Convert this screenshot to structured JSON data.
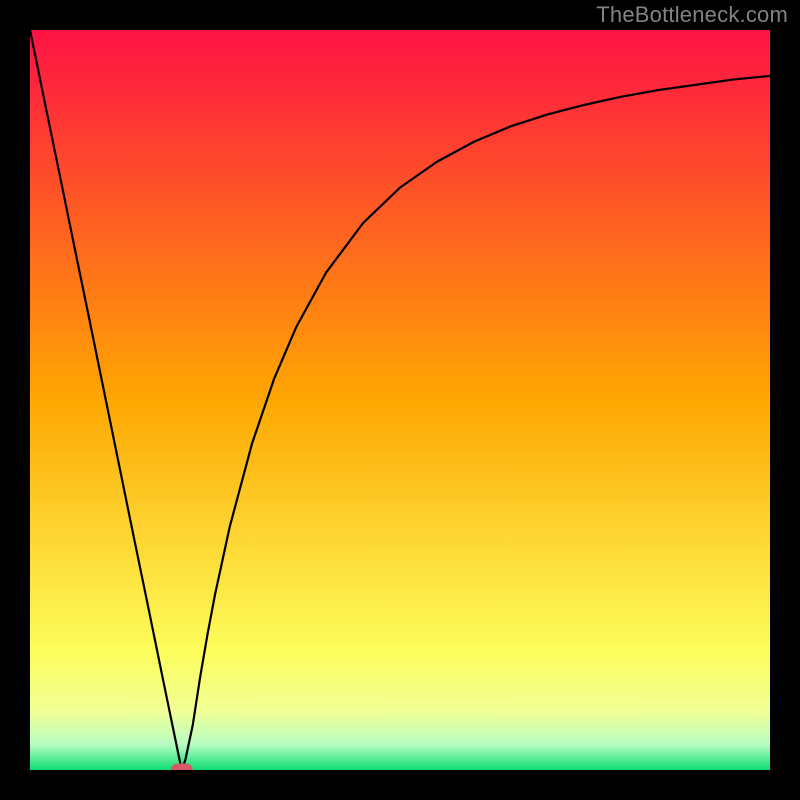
{
  "watermark": "TheBottleneck.com",
  "chart_data": {
    "type": "line",
    "title": "",
    "xlabel": "",
    "ylabel": "",
    "xlim": [
      0,
      100
    ],
    "ylim": [
      0,
      100
    ],
    "x": [
      0,
      2,
      4,
      6,
      8,
      10,
      12,
      14,
      16,
      18,
      20,
      20.5,
      21,
      22,
      23,
      24,
      25,
      27,
      30,
      33,
      36,
      40,
      45,
      50,
      55,
      60,
      65,
      70,
      75,
      80,
      85,
      90,
      95,
      100
    ],
    "y": [
      100,
      90.2,
      80.5,
      70.7,
      61.0,
      51.2,
      41.4,
      31.6,
      21.9,
      12.1,
      2.4,
      0.0,
      1.4,
      6.1,
      12.6,
      18.4,
      23.7,
      32.9,
      44.1,
      52.9,
      59.9,
      67.2,
      73.9,
      78.7,
      82.2,
      84.9,
      87.0,
      88.6,
      89.9,
      91.0,
      91.9,
      92.6,
      93.3,
      93.8
    ],
    "marker": {
      "x": 20.5,
      "y": 0.0
    },
    "background": {
      "type": "vertical_gradient",
      "stops": [
        {
          "pos": 0.0,
          "color": "#fe1244"
        },
        {
          "pos": 0.5,
          "color": "#ffa702"
        },
        {
          "pos": 0.84,
          "color": "#fcfd5b"
        },
        {
          "pos": 0.92,
          "color": "#f2ff96"
        },
        {
          "pos": 0.965,
          "color": "#b8fdc3"
        },
        {
          "pos": 1.0,
          "color": "#0edd73"
        }
      ]
    }
  }
}
